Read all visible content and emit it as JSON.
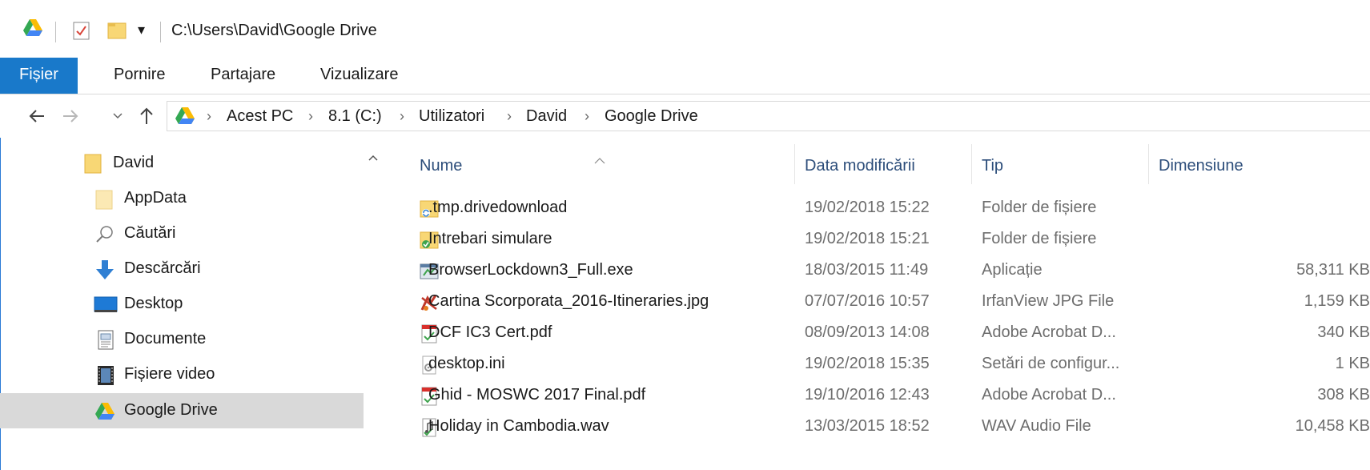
{
  "title": {
    "path": "C:\\Users\\David\\Google Drive",
    "qat_dropdown": "▾"
  },
  "ribbon": {
    "tabs": [
      {
        "label": "Fișier"
      },
      {
        "label": "Pornire"
      },
      {
        "label": "Partajare"
      },
      {
        "label": "Vizualizare"
      }
    ]
  },
  "address": {
    "crumbs": [
      "Acest PC",
      "8.1 (C:)",
      "Utilizatori",
      "David",
      "Google Drive"
    ]
  },
  "nav": {
    "items": [
      {
        "label": "David",
        "icon": "folder-icon"
      },
      {
        "label": "AppData",
        "icon": "folder-light-icon"
      },
      {
        "label": "Căutări",
        "icon": "search-icon"
      },
      {
        "label": "Descărcări",
        "icon": "download-icon"
      },
      {
        "label": "Desktop",
        "icon": "desktop-icon"
      },
      {
        "label": "Documente",
        "icon": "document-icon"
      },
      {
        "label": "Fișiere video",
        "icon": "video-icon"
      },
      {
        "label": "Google Drive",
        "icon": "google-drive-icon",
        "selected": true
      }
    ]
  },
  "list": {
    "headers": {
      "name": "Nume",
      "date": "Data modificării",
      "type": "Tip",
      "size": "Dimensiune"
    },
    "rows": [
      {
        "name": ".tmp.drivedownload",
        "date": "19/02/2018 15:22",
        "type": "Folder de fișiere",
        "size": "",
        "icon": "sync-folder-icon"
      },
      {
        "name": "Intrebari simulare",
        "date": "19/02/2018 15:21",
        "type": "Folder de fișiere",
        "size": "",
        "icon": "synced-folder-icon"
      },
      {
        "name": "BrowserLockdown3_Full.exe",
        "date": "18/03/2015 11:49",
        "type": "Aplicație",
        "size": "58,311 KB",
        "icon": "exe-icon"
      },
      {
        "name": "Cartina Scorporata_2016-Itineraries.jpg",
        "date": "07/07/2016 10:57",
        "type": "IrfanView JPG File",
        "size": "1,159 KB",
        "icon": "irfanview-icon"
      },
      {
        "name": "DCF IC3 Cert.pdf",
        "date": "08/09/2013 14:08",
        "type": "Adobe Acrobat D...",
        "size": "340 KB",
        "icon": "pdf-icon"
      },
      {
        "name": "desktop.ini",
        "date": "19/02/2018 15:35",
        "type": "Setări de configur...",
        "size": "1 KB",
        "icon": "ini-icon"
      },
      {
        "name": "Ghid - MOSWC 2017 Final.pdf",
        "date": "19/10/2016 12:43",
        "type": "Adobe Acrobat D...",
        "size": "308 KB",
        "icon": "pdf-icon"
      },
      {
        "name": "Holiday in Cambodia.wav",
        "date": "13/03/2015 18:52",
        "type": "WAV Audio File",
        "size": "10,458 KB",
        "icon": "audio-icon"
      }
    ]
  },
  "colors": {
    "accent": "#1979ca",
    "header_text": "#2c4d7a",
    "selected_bg": "#d9d9d9"
  }
}
